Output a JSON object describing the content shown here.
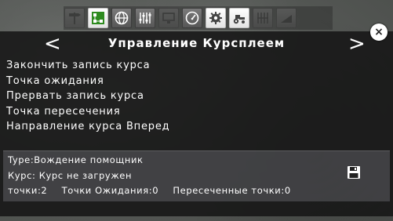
{
  "toolbar": {
    "buttons": [
      {
        "icon": "signpost-icon",
        "state": "disabled"
      },
      {
        "icon": "course-steering-icon",
        "state": "active"
      },
      {
        "icon": "globe-icon",
        "state": "normal"
      },
      {
        "icon": "sliders-icon",
        "state": "normal"
      },
      {
        "icon": "monitor-icon",
        "state": "disabled"
      },
      {
        "icon": "speedometer-icon",
        "state": "normal"
      },
      {
        "icon": "gear-icon",
        "state": "normal"
      },
      {
        "icon": "tractor-icon",
        "state": "normal"
      },
      {
        "icon": "field-grid-icon",
        "state": "disabled"
      },
      {
        "icon": "tilt-icon",
        "state": "disabled"
      }
    ]
  },
  "panel": {
    "title": "Управление Курсплеем",
    "prev_label": "<",
    "next_label": ">",
    "close_label": "×"
  },
  "menu": {
    "items": [
      "Закончить запись курса",
      "Точка ожидания",
      "Прервать запись курса",
      "Точка пересечения",
      "Направление курса Вперед"
    ]
  },
  "info": {
    "type": "Type:Вождение помощник",
    "course": "Курс: Курс не загружен",
    "points": "точки:2",
    "wait_points": "Точки Ожидания:0",
    "cross_points": "Пересеченные точки:0"
  },
  "colors": {
    "panel_bg": "#161616",
    "text": "#ffffff",
    "active_button": "#ffffff",
    "info_bg": "#9696a0"
  }
}
